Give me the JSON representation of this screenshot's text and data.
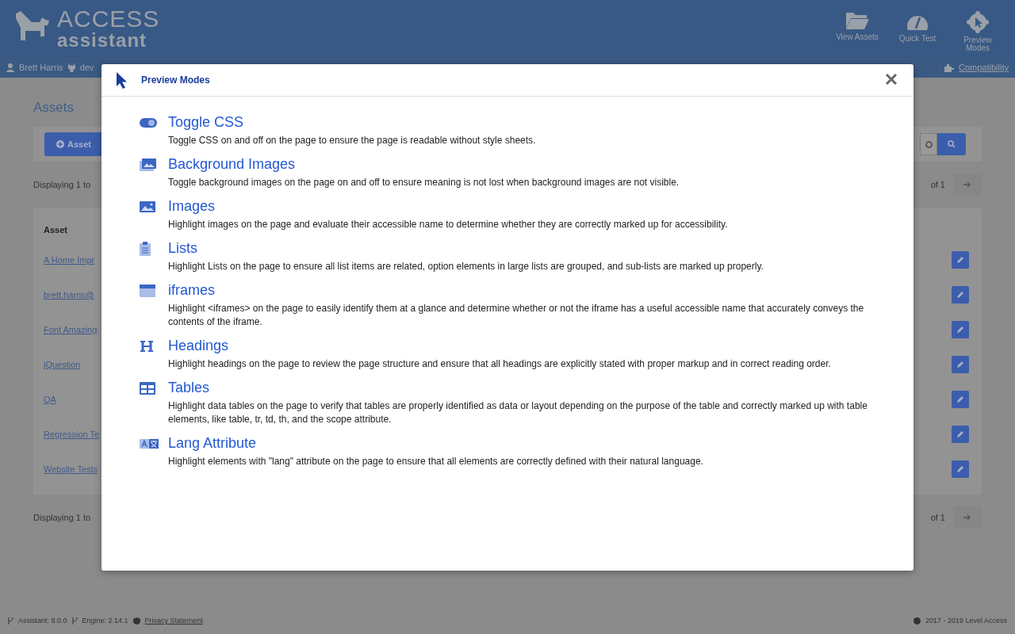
{
  "header": {
    "logo_top": "ACCESS",
    "logo_bottom": "assistant",
    "nav": [
      {
        "kind": "folder",
        "label": "View Assets"
      },
      {
        "kind": "gauge",
        "label": "Quick Test"
      },
      {
        "kind": "cursor",
        "label": "Preview Modes"
      }
    ]
  },
  "user_bar": {
    "user": "Brett Harris",
    "org": "dev",
    "compatibility": "Compatibility"
  },
  "page": {
    "title": "Assets",
    "add_button": "Asset",
    "displaying_top": "Displaying 1 to",
    "of_top": "of 1",
    "column": "Asset",
    "rows": [
      "A Home Impr",
      "brett.harris@",
      "Font Amazing",
      "jQuestion",
      "QA",
      "Regression Te",
      "Website Tests"
    ],
    "displaying_bottom": "Displaying 1 to",
    "of_bottom": "of 1"
  },
  "footer": {
    "assistant": "Assistant: 8.0.0",
    "engine": "Engine: 2.14.1",
    "privacy": "Privacy Statement",
    "copyright": "2017 - 2019 Level Access"
  },
  "modal": {
    "title": "Preview Modes",
    "items": [
      {
        "kind": "toggle",
        "title": "Toggle CSS",
        "description": "Toggle CSS on and off on the page to ensure the page is readable without style sheets."
      },
      {
        "kind": "images",
        "title": "Background Images",
        "description": "Toggle background images on the page on and off to ensure meaning is not lost when background images are not visible."
      },
      {
        "kind": "image",
        "title": "Images",
        "description": "Highlight images on the page and evaluate their accessible name to determine whether they are correctly marked up for accessibility."
      },
      {
        "kind": "list",
        "title": "Lists",
        "description": "Highlight Lists on the page to ensure all list items are related, option elements in large lists are grouped, and sub-lists are marked up properly."
      },
      {
        "kind": "frame",
        "title": "iframes",
        "description": "Highlight <iframes> on the page to easily identify them at a glance and determine whether or not the iframe has a useful accessible name that accurately conveys the contents of the iframe."
      },
      {
        "kind": "heading",
        "title": "Headings",
        "description": "Highlight headings on the page to review the page structure and ensure that all headings are explicitly stated with proper markup and in correct reading order."
      },
      {
        "kind": "table",
        "title": "Tables",
        "description": "Highlight data tables on the page to verify that tables are properly identified as data or layout depending on the purpose of the table and correctly marked up with table elements, like table, tr, td, th, and the scope attribute."
      },
      {
        "kind": "lang",
        "title": "Lang Attribute",
        "description": "Highlight elements with \"lang\" attribute on the page to ensure that all elements are correctly defined with their natural language."
      }
    ]
  }
}
